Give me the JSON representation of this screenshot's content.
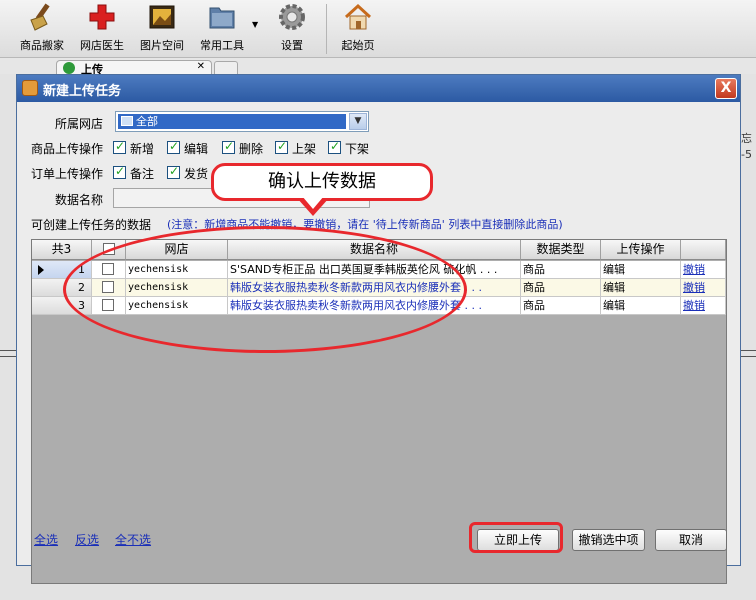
{
  "toolbar": {
    "items": [
      {
        "label": "商品搬家",
        "icon": "broom-icon"
      },
      {
        "label": "网店医生",
        "icon": "red-cross-icon"
      },
      {
        "label": "图片空间",
        "icon": "picture-icon"
      },
      {
        "label": "常用工具",
        "icon": "folder-icon"
      },
      {
        "label": "设置",
        "icon": "gear-icon"
      },
      {
        "label": "起始页",
        "icon": "home-icon"
      }
    ]
  },
  "bg": {
    "tab_label": "上传",
    "right_text_1": "忘",
    "right_text_2": "-5"
  },
  "dialog": {
    "title": "新建上传任务",
    "close_label": "X",
    "shop_label": "所属网店",
    "shop_value": "全部",
    "product_ops_label": "商品上传操作",
    "product_ops": [
      {
        "label": "新增",
        "checked": true
      },
      {
        "label": "编辑",
        "checked": true
      },
      {
        "label": "删除",
        "checked": true
      },
      {
        "label": "上架",
        "checked": true
      },
      {
        "label": "下架",
        "checked": true
      }
    ],
    "order_ops_label": "订单上传操作",
    "order_ops": [
      {
        "label": "备注",
        "checked": true
      },
      {
        "label": "发货",
        "checked": true
      }
    ],
    "data_name_label": "数据名称",
    "data_name_value": "",
    "available_label": "可创建上传任务的数据",
    "note": "(注意：新增商品不能撤销，要撤销，请在 '待上传新商品' 列表中直接删除此商品)",
    "grid": {
      "headers": {
        "count": "共3",
        "shop": "网店",
        "name": "数据名称",
        "type": "数据类型",
        "op": "上传操作",
        "action": ""
      },
      "rows": [
        {
          "index": "1",
          "shop": "yechensisk",
          "name": "S'SAND专柜正品 出口英国夏季韩版英伦风 硫化帆 . . .",
          "type": "商品",
          "op": "编辑",
          "action": "撤销"
        },
        {
          "index": "2",
          "shop": "yechensisk",
          "name": "韩版女装衣服热卖秋冬新款两用风衣内修腰外套 . . .",
          "type": "商品",
          "op": "编辑",
          "action": "撤销"
        },
        {
          "index": "3",
          "shop": "yechensisk",
          "name": "韩版女装衣服热卖秋冬新款两用风衣内修腰外套 . . .",
          "type": "商品",
          "op": "编辑",
          "action": "撤销"
        }
      ]
    },
    "links": {
      "select_all": "全选",
      "invert": "反选",
      "select_none": "全不选"
    },
    "buttons": {
      "upload": "立即上传",
      "revoke": "撤销选中项",
      "cancel": "取消"
    }
  },
  "annotation": {
    "callout_text": "确认上传数据",
    "color": "#e8282d"
  }
}
